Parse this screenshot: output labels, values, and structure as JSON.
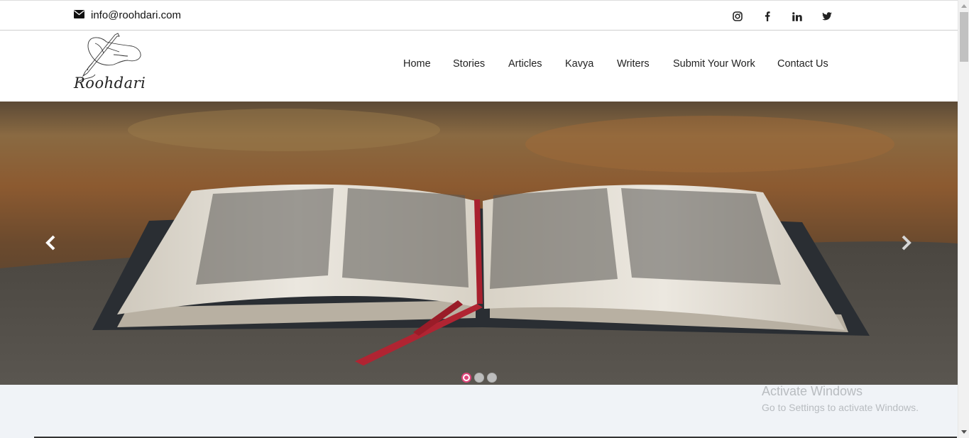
{
  "topbar": {
    "email": "info@roohdari.com",
    "email_icon": "envelope-icon",
    "socials": [
      {
        "name": "instagram-icon"
      },
      {
        "name": "facebook-icon"
      },
      {
        "name": "linkedin-icon"
      },
      {
        "name": "twitter-icon"
      }
    ]
  },
  "header": {
    "logo_text": "Roohdari",
    "nav": [
      "Home",
      "Stories",
      "Articles",
      "Kavya",
      "Writers",
      "Submit Your Work",
      "Contact Us"
    ]
  },
  "slider": {
    "slide_count": 3,
    "active_slide": 1,
    "prev_icon": "chevron-left-icon",
    "next_icon": "chevron-right-icon"
  },
  "watermark": {
    "title": "Activate Windows",
    "subtitle": "Go to Settings to activate Windows."
  },
  "colors": {
    "accent": "#e0457b",
    "text": "#222222",
    "below_bg": "#f0f3f7"
  }
}
